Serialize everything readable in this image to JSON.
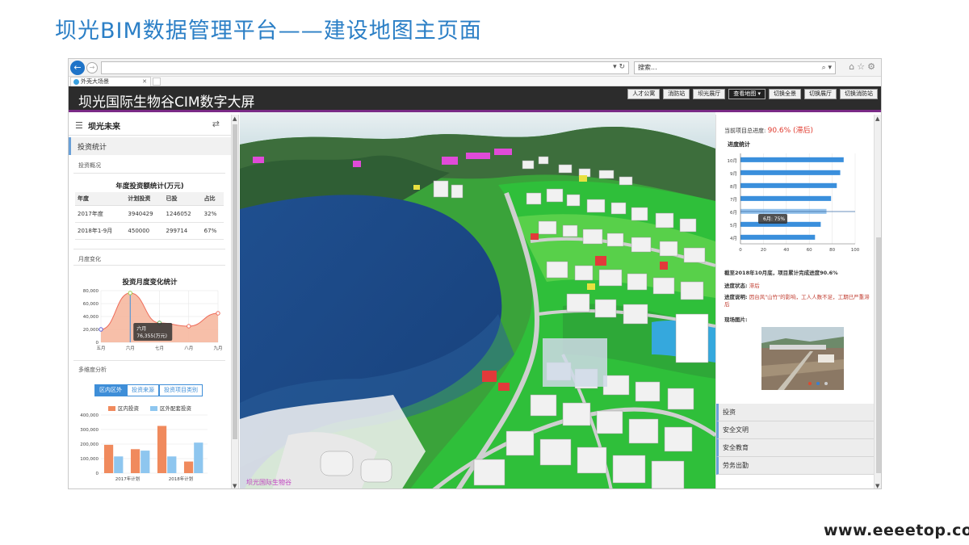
{
  "slide_title": "坝光BIM数据管理平台——建设地图主页面",
  "watermark": "www.eeeetop.com",
  "browser": {
    "search_placeholder": "搜索...",
    "tab_label": "外壳大场景"
  },
  "header": {
    "title": "坝光国际生物谷CIM数字大屏",
    "buttons": [
      "人才公寓",
      "消防站",
      "坝光展厅",
      "查看地图",
      "切换全景",
      "切换展厅",
      "切换消防站"
    ]
  },
  "left": {
    "title": "坝光未来",
    "section": "投资统计",
    "overview_label": "投资概况",
    "table_title": "年度投资额统计(万元)",
    "table": {
      "headers": [
        "年度",
        "计划投资",
        "已投",
        "占比"
      ],
      "rows": [
        [
          "2017年度",
          "3940429",
          "1246052",
          "32%"
        ],
        [
          "2018年1-9月",
          "450000",
          "299714",
          "67%"
        ]
      ]
    },
    "monthly_label": "月度变化",
    "area_chart_title": "投资月度变化统计",
    "tooltip_line1": "六月",
    "tooltip_line2": "76,355(万元)",
    "multi_label": "多维度分析",
    "segments": [
      "区内区外",
      "投资来源",
      "投资项目类别"
    ],
    "legend": [
      "区内投资",
      "区外配套投资"
    ]
  },
  "right": {
    "progress_label": "当前项目总进度:",
    "progress_value": "90.6% (滞后)",
    "progress_chart_title": "进度统计",
    "tooltip": "6月: 75%",
    "summary": "截至2018年10月底，项目累计完成进度90.6%",
    "status_label": "进度状态:",
    "status_value": "滞后",
    "desc_label": "进度说明:",
    "desc_value": "因台风\"山竹\"的影响，工人人数不足，工期已严重滞后",
    "photo_label": "现场图片:",
    "tabs": [
      "投资",
      "安全文明",
      "安全教育",
      "劳务出勤"
    ]
  },
  "map_label": "坝光国际生物谷",
  "colors": {
    "accent": "#2b7fc6",
    "header_bg": "#2c2c2c",
    "area_fill": "#f6b49a",
    "bar_orange": "#f08a5d",
    "bar_blue": "#8ec6ef",
    "hbar_blue": "#3a8fdc"
  },
  "chart_data": [
    {
      "type": "area",
      "title": "投资月度变化统计",
      "categories": [
        "五月",
        "六月",
        "七月",
        "八月",
        "九月"
      ],
      "values": [
        20000,
        76355,
        30000,
        25000,
        45000
      ],
      "ylim": [
        0,
        80000
      ],
      "yticks": [
        "0",
        "20,000",
        "40,000",
        "60,000",
        "80,000"
      ]
    },
    {
      "type": "bar",
      "categories": [
        "2017年计划",
        "2018年计划"
      ],
      "series": [
        {
          "name": "区内投资",
          "values": [
            195000,
            165000,
            325000,
            80000
          ]
        },
        {
          "name": "区外配套投资",
          "values": [
            115000,
            155000,
            115000,
            210000
          ]
        }
      ],
      "ylim": [
        0,
        400000
      ],
      "yticks": [
        "0",
        "100,000",
        "200,000",
        "300,000",
        "400,000"
      ]
    },
    {
      "type": "bar",
      "orientation": "horizontal",
      "title": "进度统计",
      "categories": [
        "10月",
        "9月",
        "8月",
        "7月",
        "6月",
        "5月",
        "4月"
      ],
      "values": [
        90,
        87,
        84,
        79,
        75,
        70,
        65
      ],
      "xlim": [
        0,
        100
      ],
      "xticks": [
        "0",
        "20",
        "40",
        "60",
        "80",
        "100"
      ]
    }
  ]
}
